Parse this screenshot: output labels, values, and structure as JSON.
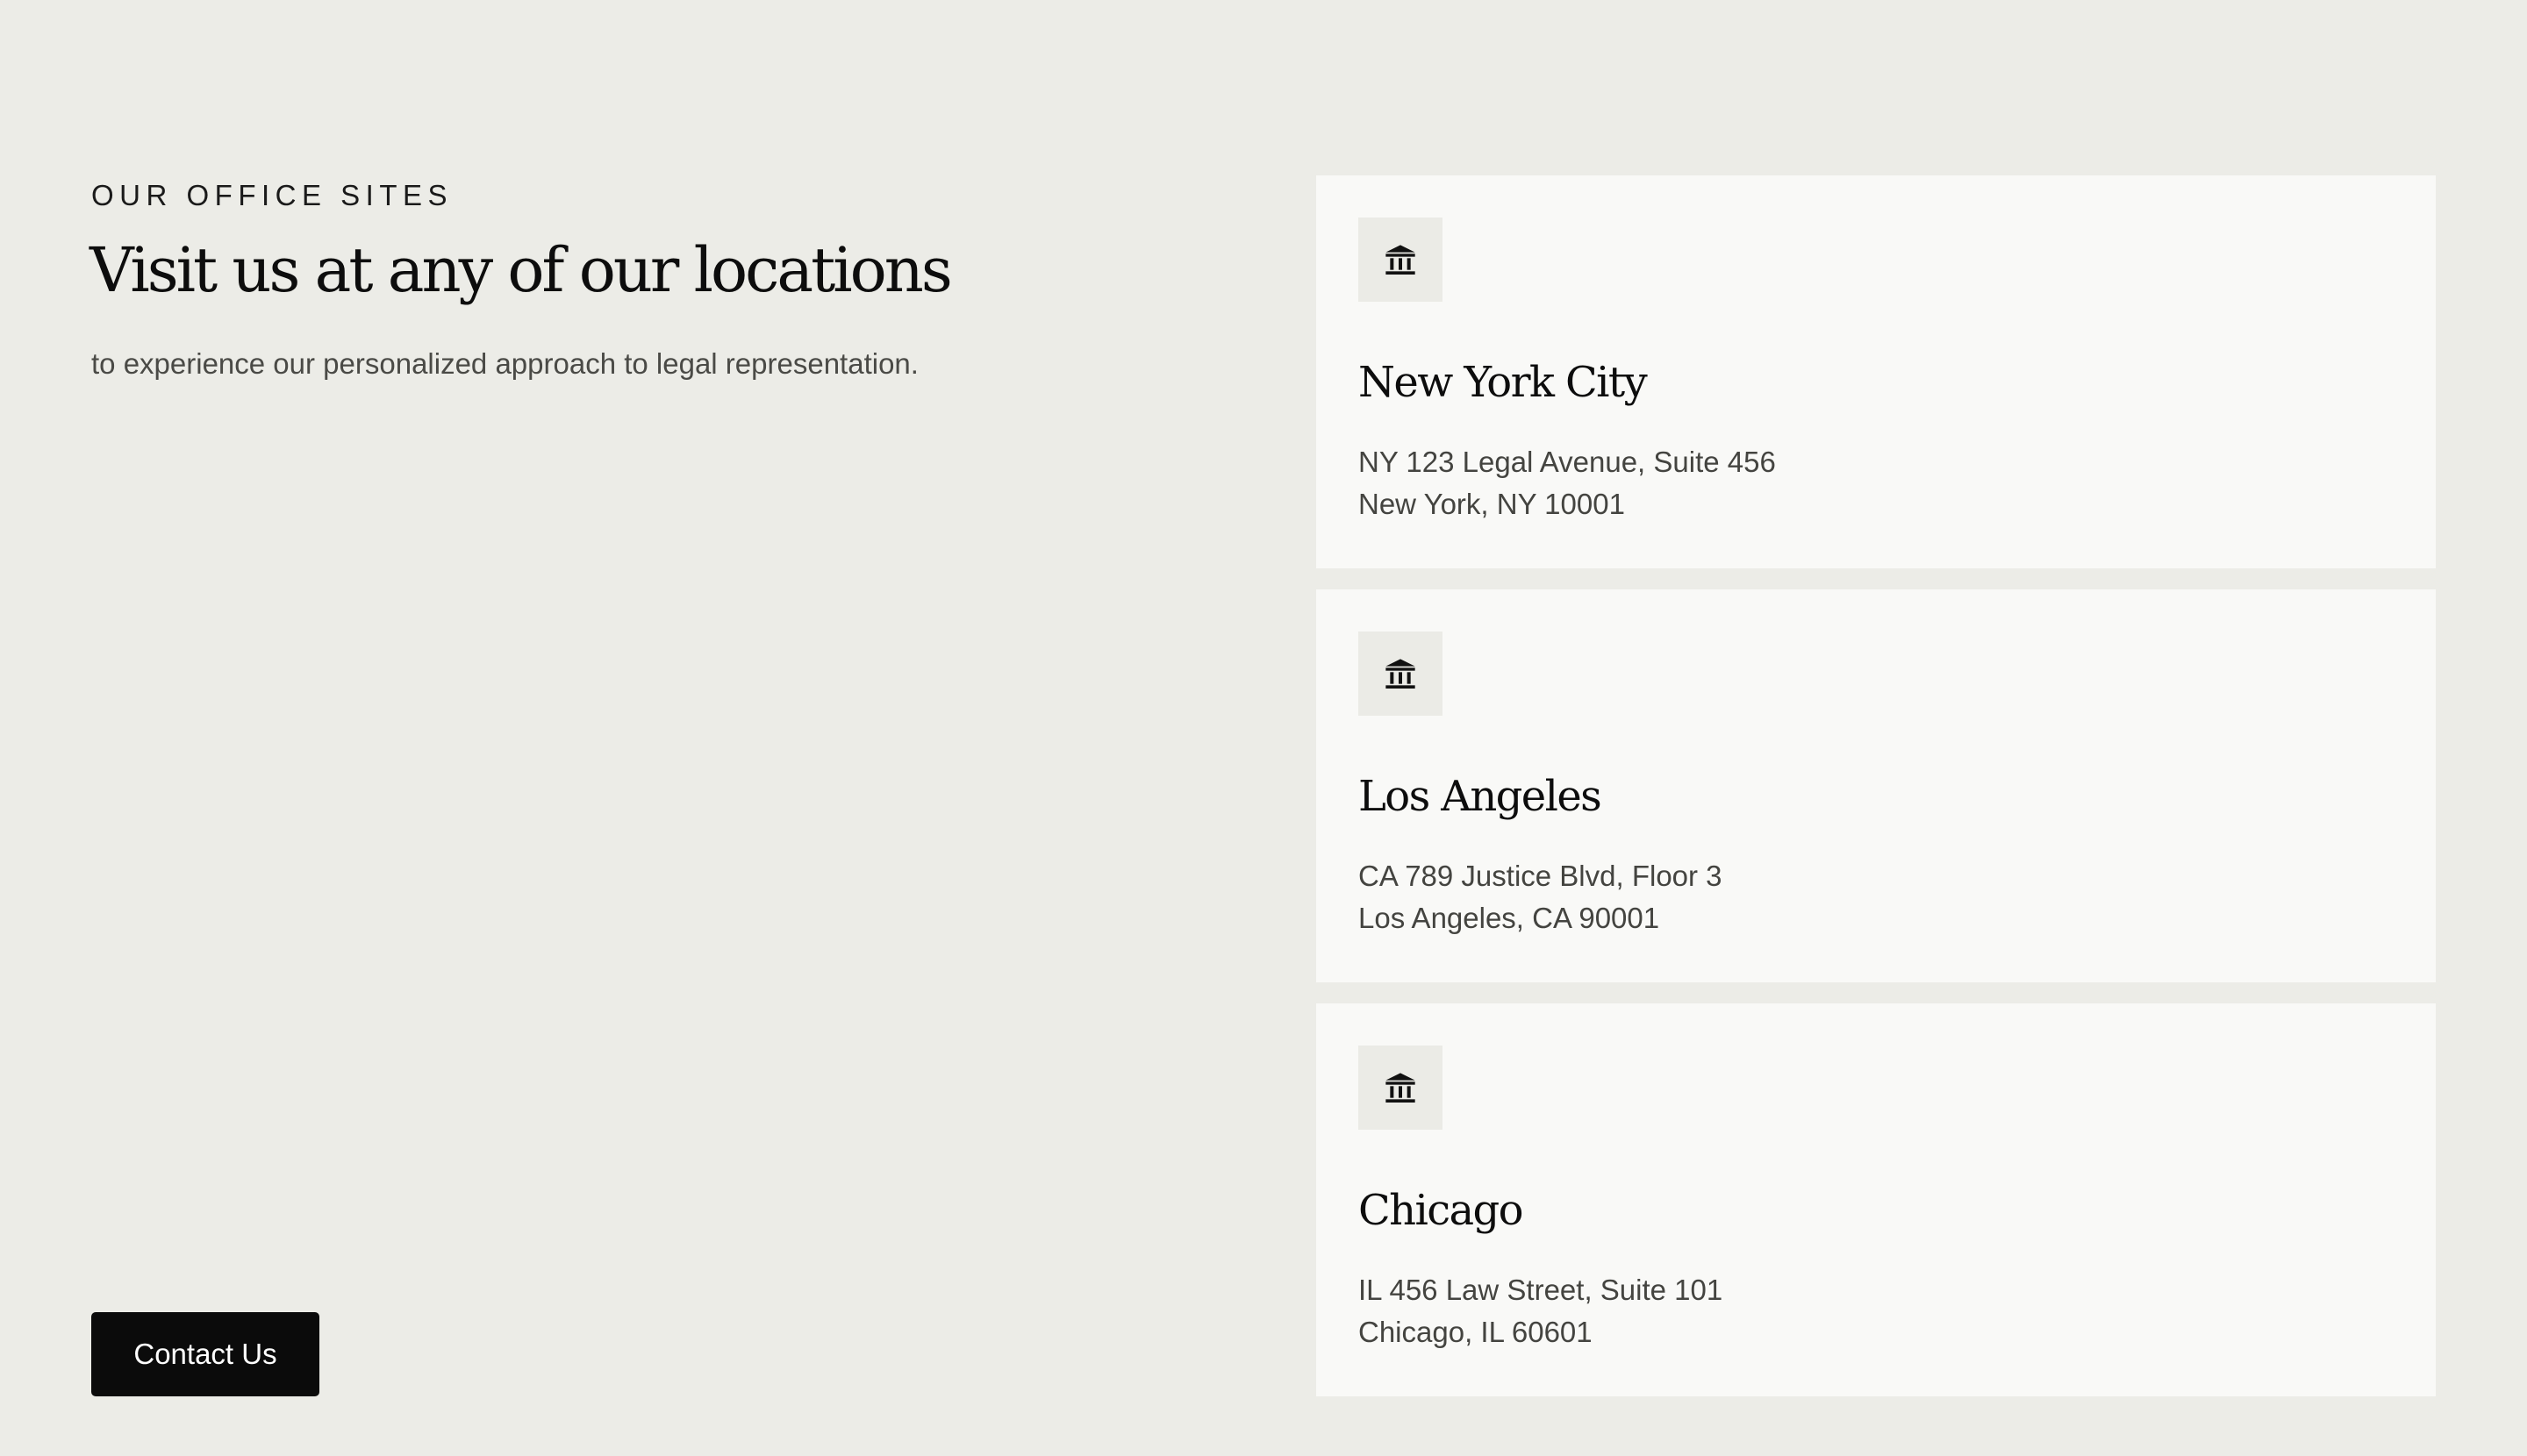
{
  "section": {
    "eyebrow": "OUR OFFICE SITES",
    "title": "Visit us at any of our locations",
    "subtitle": "to experience our personalized approach to legal representation.",
    "cta_label": "Contact Us"
  },
  "locations": [
    {
      "icon": "courthouse-icon",
      "name": "New York City",
      "address_line1": "NY 123 Legal Avenue, Suite 456",
      "address_line2": "New York, NY 10001"
    },
    {
      "icon": "courthouse-icon",
      "name": "Los Angeles",
      "address_line1": "CA 789 Justice Blvd, Floor 3",
      "address_line2": "Los Angeles, CA 90001"
    },
    {
      "icon": "courthouse-icon",
      "name": "Chicago",
      "address_line1": "IL 456 Law Street, Suite 101",
      "address_line2": "Chicago, IL 60601"
    }
  ],
  "colors": {
    "page_background": "#ecece7",
    "card_background": "#f9f9f7",
    "icon_background": "#ebebe6",
    "button_background": "#0b0b0b",
    "button_text": "#ffffff",
    "heading_text": "#0d0d0d",
    "body_text": "#444440"
  }
}
